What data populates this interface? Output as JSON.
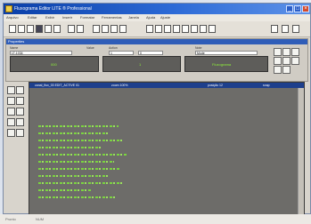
{
  "window": {
    "title": "Fluxograma Editor LITE ® Professional"
  },
  "menu": [
    "Arquivo",
    "Editar",
    "Exibir",
    "Inserir",
    "Formatar",
    "Ferramentas",
    "Janela",
    "Ajuda",
    "Ajuste"
  ],
  "panel": {
    "title": "Properties",
    "labels": [
      "Name",
      "Value",
      "Action",
      "Note"
    ],
    "values": [
      "LT-1034",
      "1",
      "0",
      "Mode"
    ]
  },
  "displays": {
    "left": "000",
    "middle": "1",
    "right": "Fluxograma"
  },
  "canvas": {
    "header": [
      "canal_flux_03 EDIT_ACTIVE 01",
      "zoom 100%",
      "posição 12",
      "snap"
    ]
  },
  "status": {
    "left": "Pronto",
    "right": "NUM"
  },
  "colors": {
    "accent": "#2c6ad6",
    "trace": "#7be13a",
    "canvas": "#6d6c69"
  }
}
